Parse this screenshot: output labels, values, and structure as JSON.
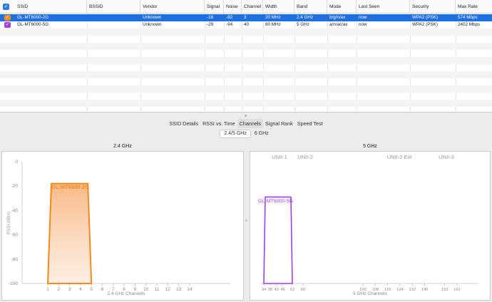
{
  "table": {
    "columns": [
      {
        "label": "SSID"
      },
      {
        "label": "BSSID"
      },
      {
        "label": "Vendor"
      },
      {
        "label": "Signal"
      },
      {
        "label": "Noise"
      },
      {
        "label": "Channel"
      },
      {
        "label": "Width"
      },
      {
        "label": "Band"
      },
      {
        "label": "Mode"
      },
      {
        "label": "Last Seen"
      },
      {
        "label": "Security"
      },
      {
        "label": "Max Rate"
      }
    ],
    "rows": [
      {
        "checked": true,
        "color": "#f28a1c",
        "ssid": "GL-MT6000-2G",
        "bssid": "",
        "vendor": "Unknown",
        "signal": "-18",
        "noise": "-92",
        "channel": "3",
        "width": "20 MHz",
        "band": "2.4 GHz",
        "mode": "b/g/n/ax",
        "last_seen": "now",
        "security": "WPA2 (PSK)",
        "max_rate": "574 Mbps"
      },
      {
        "checked": true,
        "color": "#a23fe8",
        "ssid": "GL-MT6000-5G",
        "bssid": "",
        "vendor": "Unknown",
        "signal": "-29",
        "noise": "-94",
        "channel": "40",
        "width": "80 MHz",
        "band": "5 GHz",
        "mode": "a/n/ac/ax",
        "last_seen": "now",
        "security": "WPA2 (PSK)",
        "max_rate": "2402 Mbps"
      }
    ]
  },
  "tabs": {
    "ssid_details": "SSID Details",
    "rssi_time": "RSSI vs. Time",
    "channels": "Channels",
    "signal_rank": "Signal Rank",
    "speed_test": "Speed Test"
  },
  "subtabs": {
    "band_24_5": "2.4/5 GHz",
    "band_6": "6 GHz"
  },
  "colors": {
    "selection": "#1f6fe0",
    "accent": "#2f7ae5",
    "network_2g": "#f28a1c",
    "network_5g": "#a23fe8"
  },
  "chart_data": [
    {
      "type": "area",
      "title": "2.4 GHz",
      "xlabel": "2.4 GHz Channels",
      "ylabel": "RSSI (dBm)",
      "ylim": [
        -100,
        0
      ],
      "y_ticks": [
        "0",
        "-20",
        "-40",
        "-60",
        "-80",
        "-100"
      ],
      "x_ticks": [
        "1",
        "2",
        "3",
        "4",
        "5",
        "6",
        "7",
        "8",
        "9",
        "10",
        "11",
        "12",
        "13",
        "14"
      ],
      "grid": false,
      "series": [
        {
          "name": "GL-MT6000-2G",
          "channel": 3,
          "width_mhz": 20,
          "rssi": -18,
          "color": "#f28a1c"
        }
      ]
    },
    {
      "type": "area",
      "title": "5 GHz",
      "xlabel": "5 GHz Channels",
      "ylim": [
        -100,
        0
      ],
      "x_ticks": [
        "34",
        "38",
        "42",
        "46",
        "52",
        "60",
        "100",
        "108",
        "116",
        "124",
        "132",
        "140",
        "153",
        "161"
      ],
      "band_labels": [
        "UNII-1",
        "UNII-2",
        "UNII-2 Ext",
        "UNII-3"
      ],
      "grid": false,
      "series": [
        {
          "name": "GL-MT6000-5G",
          "channel": 40,
          "width_mhz": 80,
          "rssi": -29,
          "color": "#a23fe8"
        }
      ]
    }
  ]
}
